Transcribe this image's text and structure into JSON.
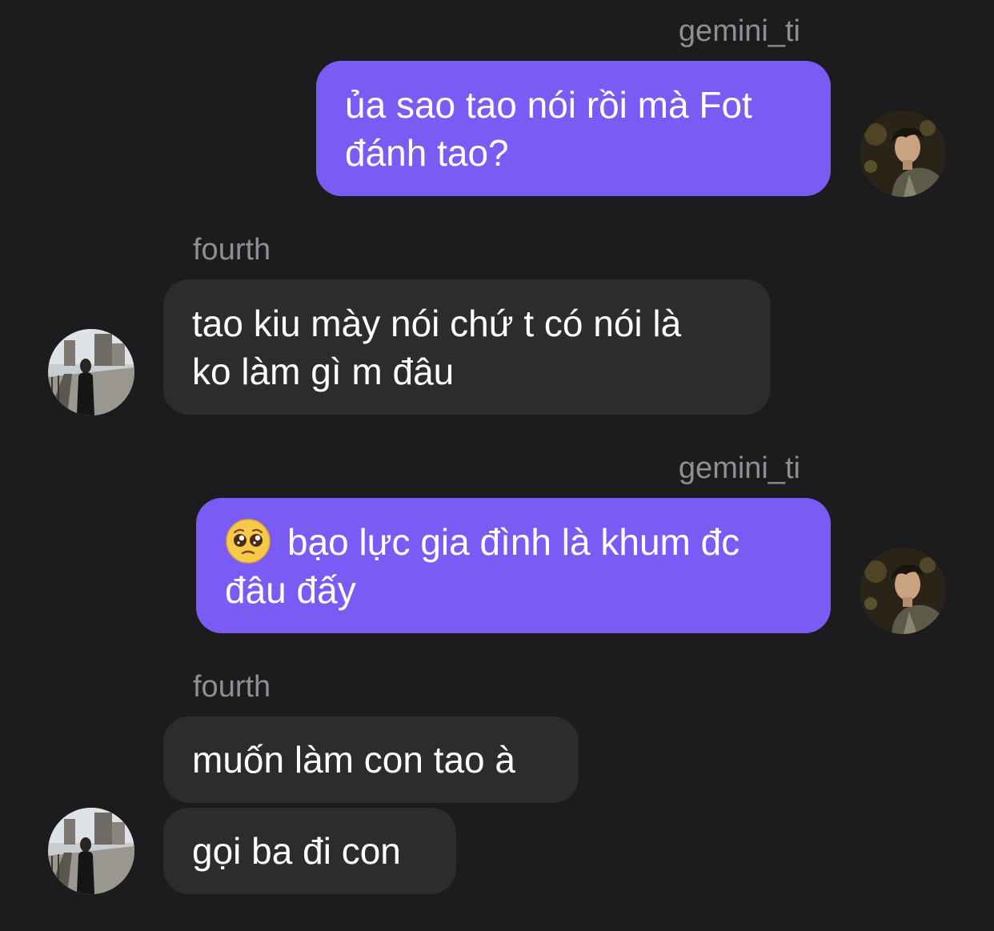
{
  "conversation": {
    "messages": [
      {
        "sender": "gemini_ti",
        "side": "sent",
        "text": "ủa sao tao nói rồi mà Fot đánh tao?"
      },
      {
        "sender": "fourth",
        "side": "received",
        "text": "tao kiu mày nói chứ t có nói là ko làm gì m đâu"
      },
      {
        "sender": "gemini_ti",
        "side": "sent",
        "emoji": "pleading-face",
        "text": "bạo lực gia đình là khum đc đâu đấy"
      },
      {
        "sender": "fourth",
        "side": "received",
        "text": "muốn làm con tao à"
      },
      {
        "side": "received",
        "text": "gọi ba đi con"
      }
    ]
  },
  "labels": {
    "sender_1": "gemini_ti",
    "sender_2": "fourth",
    "sender_3": "gemini_ti",
    "sender_4": "fourth"
  },
  "bubbles": {
    "b1_line1": "ủa sao tao nói rồi mà Fot",
    "b1_line2": "đánh tao?",
    "b2_line1": "tao kiu mày nói chứ t có nói là",
    "b2_line2": "ko làm gì m đâu",
    "b3_line1": "bạo lực gia đình là khum đc",
    "b3_line2": "đâu đấy",
    "b4": "muốn làm con tao à",
    "b5": "gọi ba đi con"
  },
  "icons": {
    "gemini_avatar": "avatar-photo-man-profile",
    "fourth_avatar": "avatar-photo-person-street",
    "emoji": "pleading-face-emoji"
  },
  "colors": {
    "background": "#1c1c1e",
    "sent_bubble": "#7a5cf5",
    "received_bubble": "#2c2c2e",
    "sender_label": "#8e8e93",
    "text": "#ffffff"
  }
}
